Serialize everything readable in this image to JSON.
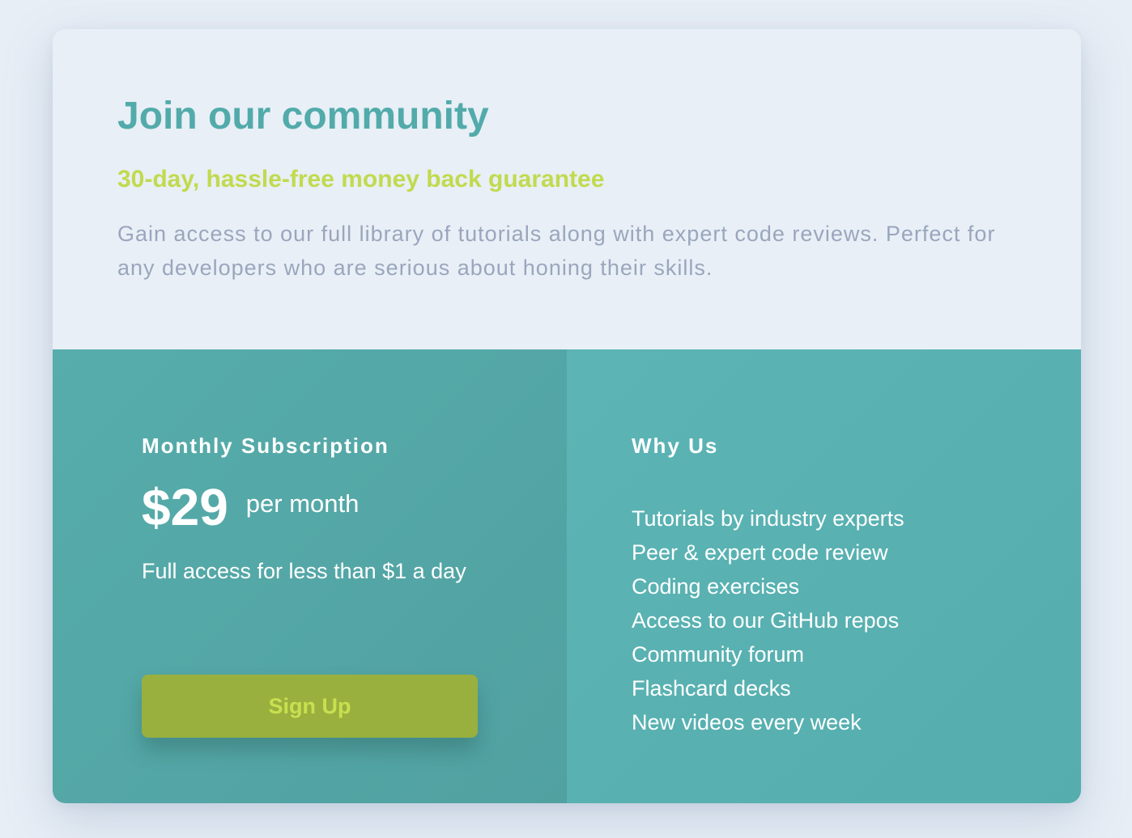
{
  "header": {
    "title": "Join our community",
    "guarantee": "30-day, hassle-free money back guarantee",
    "description": "Gain access to our full library of tutorials along with expert code reviews. Perfect for any developers who are serious about honing their skills."
  },
  "subscription": {
    "heading": "Monthly Subscription",
    "price": "$29",
    "period": "per month",
    "tagline": "Full access for less than $1 a day",
    "signup_label": "Sign Up"
  },
  "why_us": {
    "heading": "Why Us",
    "features": [
      "Tutorials by industry experts",
      "Peer & expert code review",
      "Coding exercises",
      "Access to our GitHub repos",
      "Community forum",
      "Flashcard decks",
      "New videos every week"
    ]
  },
  "colors": {
    "page_background": "#e7eef6",
    "title": "#52abaa",
    "guarantee": "#c1da4e",
    "description": "#9aa6bd",
    "left_panel": "#53a7a6",
    "right_panel": "#5ab1b1",
    "button": "#99b03e",
    "button_text": "#c8e050"
  }
}
